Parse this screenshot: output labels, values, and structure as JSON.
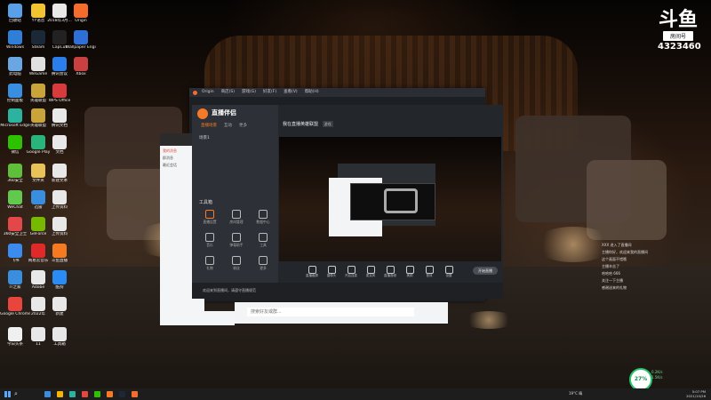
{
  "douyu": {
    "mark": "斗鱼",
    "room_label": "房间号",
    "room_id": "4323460"
  },
  "desktop_icons": [
    {
      "label": "回收站",
      "color": "#5aa0e8"
    },
    {
      "label": "YY语音",
      "color": "#f4c430"
    },
    {
      "label": "2018年3月...",
      "color": "#e8e8e8"
    },
    {
      "label": "Origin",
      "color": "#f56c2d"
    },
    {
      "label": "Windows",
      "color": "#2f7fd8"
    },
    {
      "label": "Steam",
      "color": "#1b2838"
    },
    {
      "label": "CapCut",
      "color": "#222"
    },
    {
      "label": "Wallpaper Engine",
      "color": "#2e6fd8"
    },
    {
      "label": "此电脑",
      "color": "#6aa6e2"
    },
    {
      "label": "WeGame",
      "color": "#e0e0e0"
    },
    {
      "label": "腾讯会议",
      "color": "#2b7de9"
    },
    {
      "label": "Xbox",
      "color": "#c84040"
    },
    {
      "label": "控制面板",
      "color": "#3a8ee0"
    },
    {
      "label": "英雄联盟",
      "color": "#c9a43a"
    },
    {
      "label": "WPS Office",
      "color": "#d83b3b"
    },
    {
      "label": "Microsoft Edge",
      "color": "#2cb3a0"
    },
    {
      "label": "英雄联盟",
      "color": "#c9a43a"
    },
    {
      "label": "腾讯文档",
      "color": "#e8e8e8"
    },
    {
      "label": "微信",
      "color": "#2dc100"
    },
    {
      "label": "Google Play",
      "color": "#28b47a"
    },
    {
      "label": "文档",
      "color": "#e8e8e8"
    },
    {
      "label": "360安全",
      "color": "#5fbf3a"
    },
    {
      "label": "文件夹",
      "color": "#e8c35a"
    },
    {
      "label": "新建文本",
      "color": "#e8e8e8"
    },
    {
      "label": "WeChat",
      "color": "#62c94f"
    },
    {
      "label": "迅雷",
      "color": "#3a8ee0"
    },
    {
      "label": "上传资料",
      "color": "#e8e8e8"
    },
    {
      "label": "360安全卫士",
      "color": "#e2484a"
    },
    {
      "label": "GeForce",
      "color": "#76b900"
    },
    {
      "label": "上传资料",
      "color": "#e8e8e8"
    },
    {
      "label": "飞书",
      "color": "#3c8cf0"
    },
    {
      "label": "网易云音乐",
      "color": "#e02a2a"
    },
    {
      "label": "斗鱼直播",
      "color": "#f57a22"
    },
    {
      "label": "IT之家",
      "color": "#3a8ee0"
    },
    {
      "label": "Adobe",
      "color": "#e8e8e8"
    },
    {
      "label": "酷狗",
      "color": "#2a8bf2"
    },
    {
      "label": "Google Chrome",
      "color": "#e8453c"
    },
    {
      "label": "2022年",
      "color": "#e8e8e8"
    },
    {
      "label": "新建",
      "color": "#e8e8e8"
    },
    {
      "label": "今日头条",
      "color": "#f0f0f0"
    },
    {
      "label": "11",
      "color": "#e8e8e8"
    },
    {
      "label": "工具箱",
      "color": "#e8e8e8"
    }
  ],
  "origin": {
    "title": "Origin",
    "menus": [
      "商店(S)",
      "游戏(G)",
      "好友(F)",
      "查看(V)",
      "帮助(H)"
    ]
  },
  "chat": {
    "tabs": [
      "我的消息",
      "群消息",
      "最近会话"
    ],
    "search_placeholder": "搜索好友或群..."
  },
  "streamer": {
    "brand": "直播伴侣",
    "tabs": [
      "直播场景",
      "互动",
      "更多"
    ],
    "scene_label": "场景1",
    "tools_title": "工具箱",
    "tools": [
      "直播设置",
      "房间管理",
      "数据中心",
      "音乐",
      "弹幕助手",
      "工具",
      "礼物",
      "粉丝",
      "更多"
    ],
    "room_title": "我在直播英雄联盟",
    "room_badge": "游戏",
    "controls": [
      "直播截屏",
      "摄像头",
      "开启连麦",
      "麦克风",
      "直播音频",
      "美颜",
      "音效",
      "设置"
    ],
    "start_label": "开始直播",
    "footer": "欢迎来到直播间，请遵守直播规范"
  },
  "overlay_chat": [
    "XXX 进入了直播间",
    "主播你好，欢迎来我的直播间",
    "这个画面不错哦",
    "主播辛苦了",
    "哈哈哈 666",
    "关注一下主播",
    "感谢送来的礼物"
  ],
  "speed": {
    "value": "27%",
    "up": "0.2K/s",
    "down": "1.5K/s"
  },
  "taskbar": {
    "temperature": "19°C 晴",
    "time": "5:07 PM",
    "date": "2021/10/26",
    "apps": [
      "#3a8ee0",
      "#f5b400",
      "#2cb3a0",
      "#e8453c",
      "#2dc100",
      "#f57a22",
      "#1b2838",
      "#f56c2d"
    ]
  }
}
